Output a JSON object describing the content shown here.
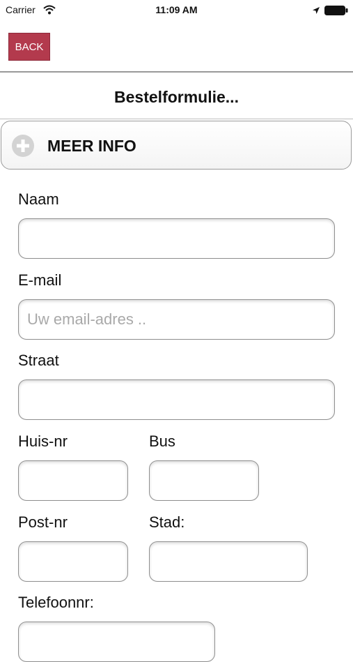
{
  "status_bar": {
    "carrier": "Carrier",
    "time": "11:09 AM",
    "icons": [
      "wifi-icon",
      "location-icon",
      "battery-icon"
    ]
  },
  "nav": {
    "back_label": "BACK"
  },
  "header": {
    "title": "Bestelformulie..."
  },
  "collapsible": {
    "label": "MEER INFO",
    "icon": "plus-icon"
  },
  "form": {
    "naam": {
      "label": "Naam",
      "value": "",
      "placeholder": ""
    },
    "email": {
      "label": "E-mail",
      "value": "",
      "placeholder": "Uw email-adres .."
    },
    "straat": {
      "label": "Straat",
      "value": "",
      "placeholder": ""
    },
    "huisnr": {
      "label": "Huis-nr",
      "value": "",
      "placeholder": ""
    },
    "bus": {
      "label": "Bus",
      "value": "",
      "placeholder": ""
    },
    "postnr": {
      "label": "Post-nr",
      "value": "",
      "placeholder": ""
    },
    "stad": {
      "label": "Stad:",
      "value": "",
      "placeholder": ""
    },
    "telefoon": {
      "label": "Telefoonnr:",
      "value": "",
      "placeholder": ""
    }
  },
  "colors": {
    "back_button": "#b33a4d",
    "placeholder": "#a9a9a9",
    "border": "#8f8f8f"
  }
}
